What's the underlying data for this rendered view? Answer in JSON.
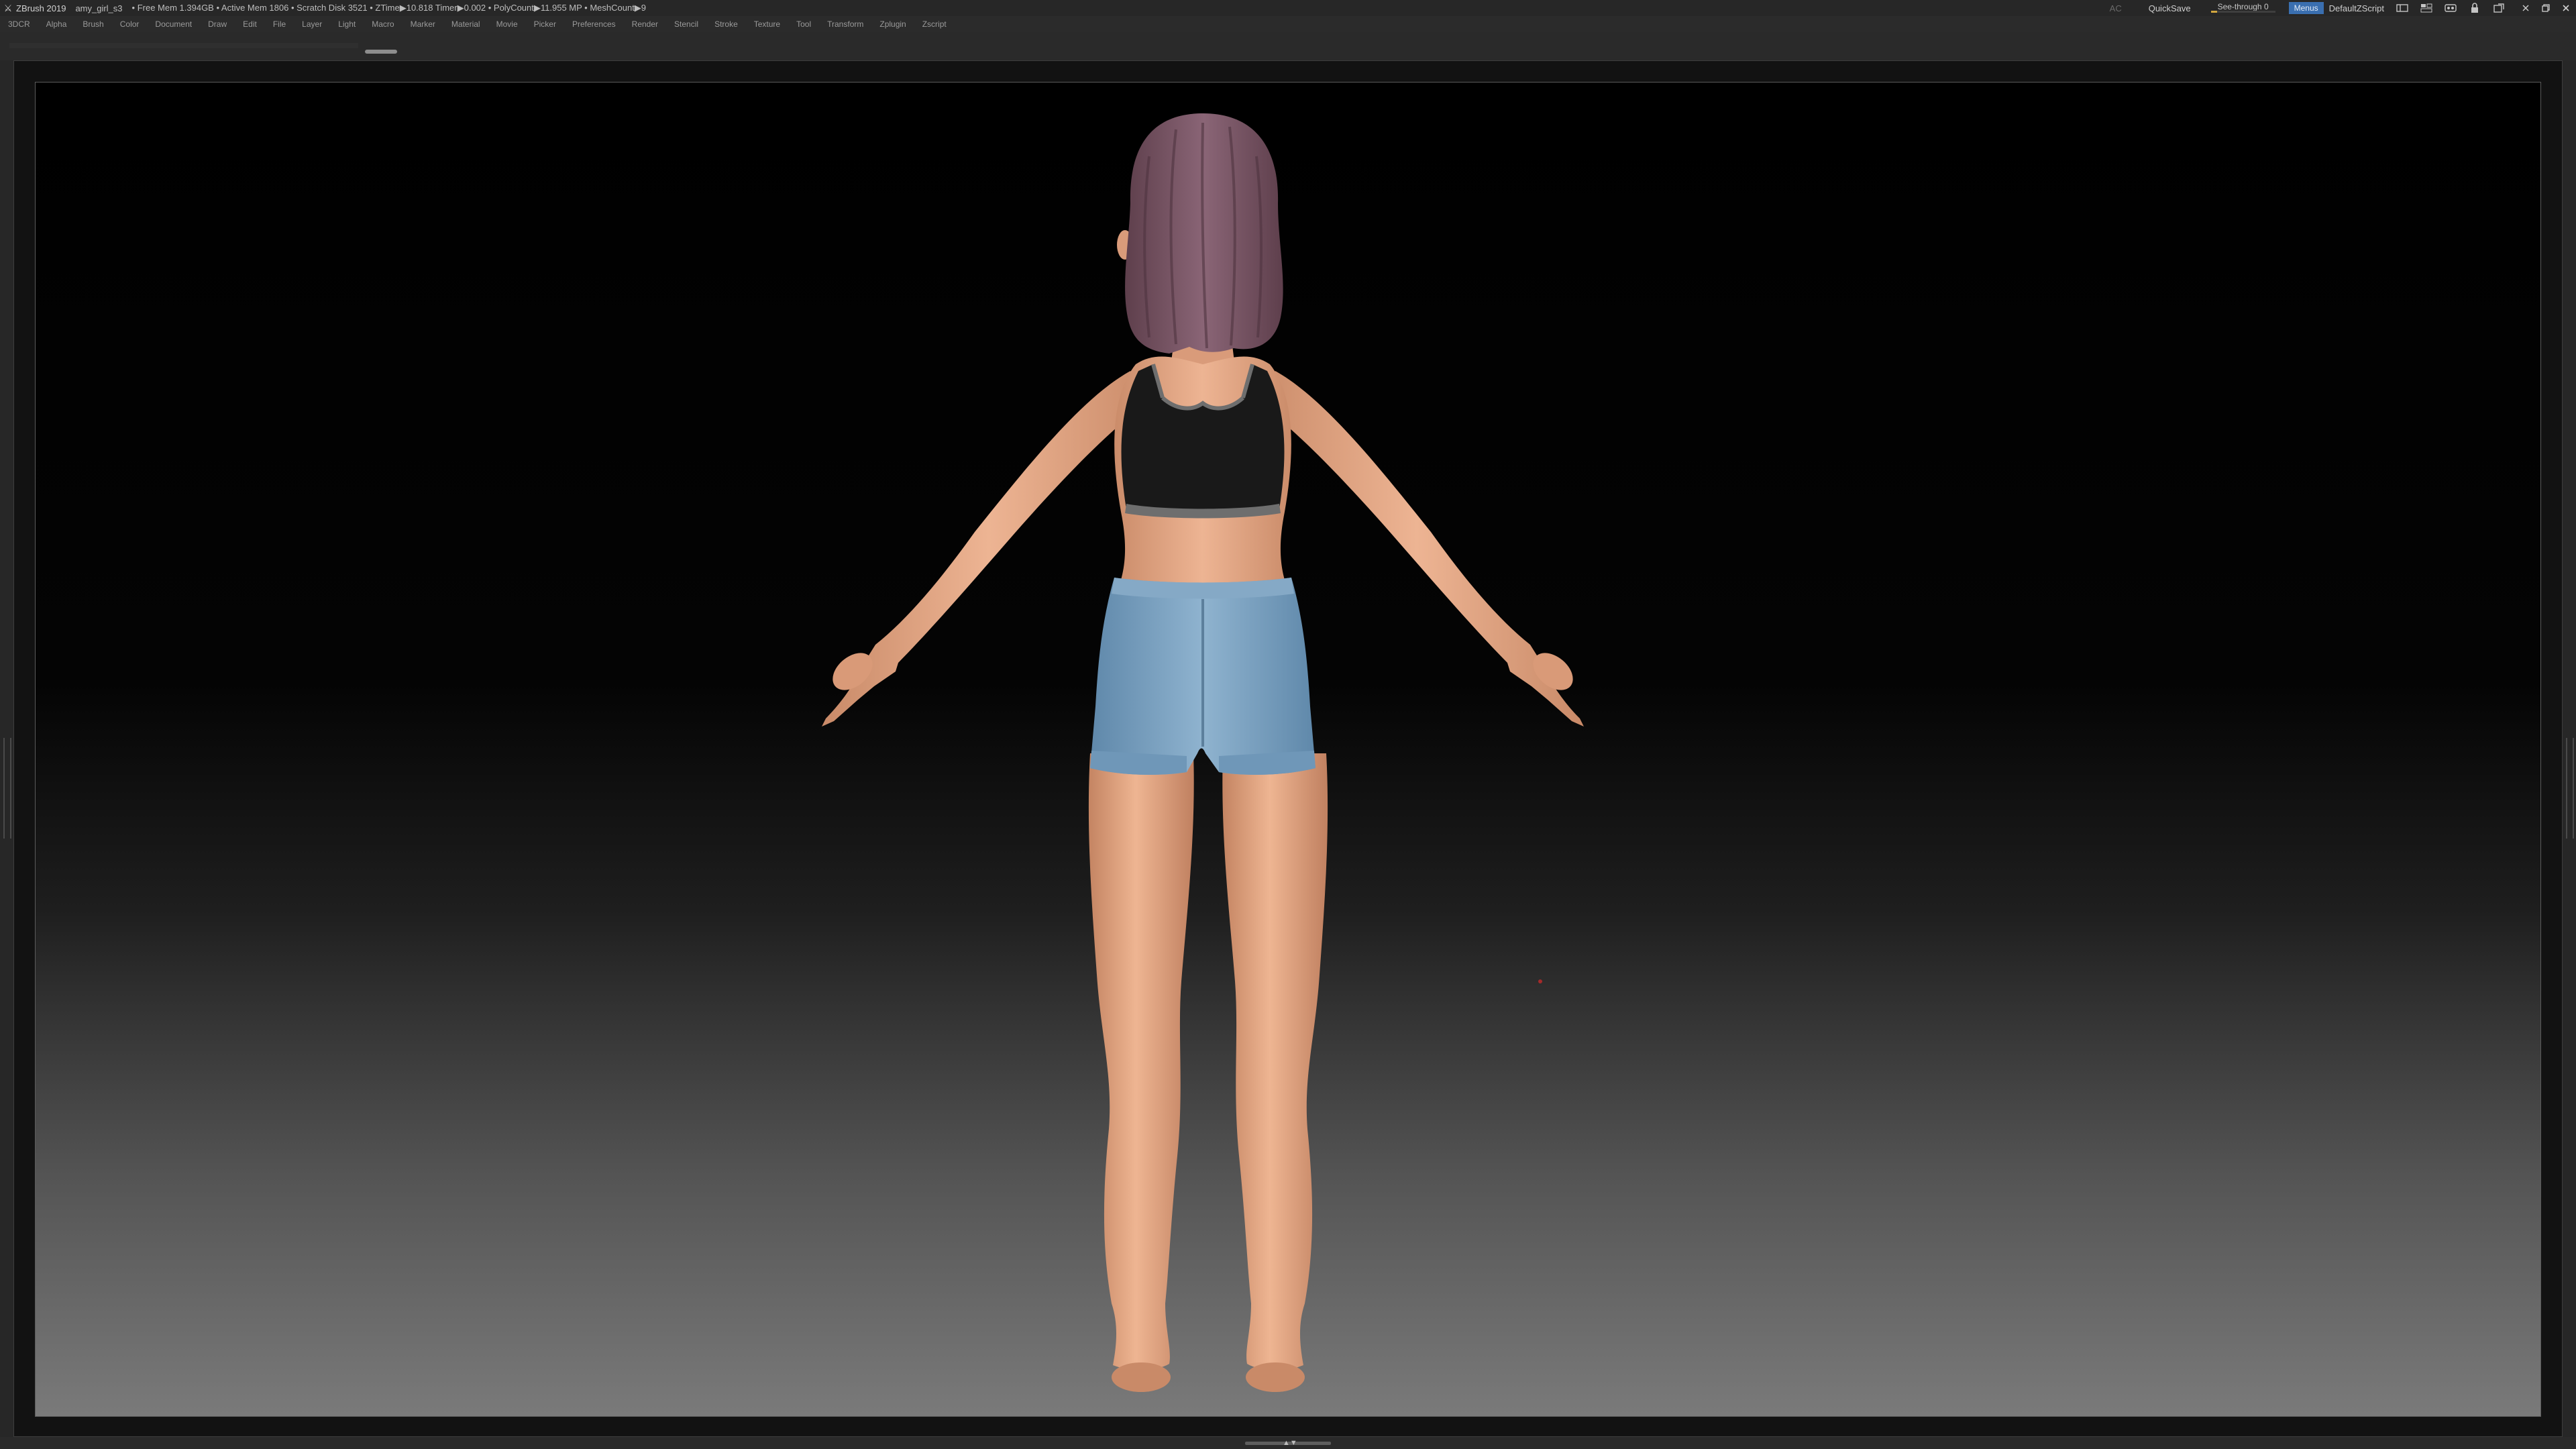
{
  "titlebar": {
    "app_name": "ZBrush 2019",
    "file_name": "amy_girl_s3",
    "stats": "• Free Mem 1.394GB • Active Mem 1806 • Scratch Disk 3521 •  ZTime▶10.818 Timer▶0.002 • PolyCount▶11.955 MP • MeshCount▶9",
    "ac_label": "AC",
    "quicksave_label": "QuickSave",
    "seethrough_label": "See-through  0",
    "seethrough_value": 0.1,
    "menus_label": "Menus",
    "script_label": "DefaultZScript"
  },
  "menubar": {
    "items": [
      "3DCR",
      "Alpha",
      "Brush",
      "Color",
      "Document",
      "Draw",
      "Edit",
      "File",
      "Layer",
      "Light",
      "Macro",
      "Marker",
      "Material",
      "Movie",
      "Picker",
      "Preferences",
      "Render",
      "Stencil",
      "Stroke",
      "Texture",
      "Tool",
      "Transform",
      "Zplugin",
      "Zscript"
    ]
  },
  "icons": {
    "app_logo": "zbrush-logo-icon",
    "toolbar": [
      "layout-icon",
      "palette-icon",
      "interface-icon",
      "lock-icon",
      "undock-icon"
    ],
    "window": [
      "minimize-icon",
      "restore-icon",
      "close-icon"
    ]
  },
  "colors": {
    "accent": "#3a6fb0",
    "slider_fill": "#d1a63f",
    "skin": "#e7a986",
    "hair": "#7e5a6a",
    "top": "#1a1a1a",
    "shorts": "#7ea6c6"
  }
}
